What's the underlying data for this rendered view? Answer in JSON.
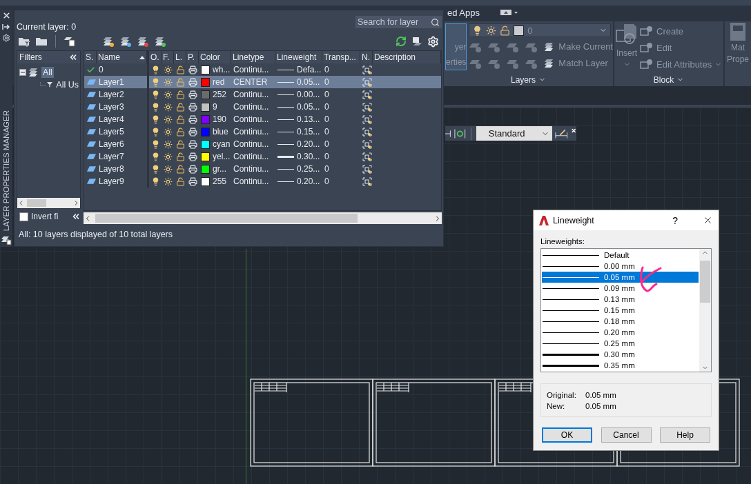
{
  "ribbon": {
    "tab_fragment": "ed Apps",
    "layers_panel": {
      "big_button": [
        "yer",
        "erties"
      ],
      "dropdown": {
        "value": "0",
        "color": "#c8ccd2"
      },
      "buttons": [
        "Make Current",
        "Match Layer"
      ],
      "title": "Layers"
    },
    "block_panel": {
      "insert": "Insert",
      "buttons": [
        "Create",
        "Edit",
        "Edit Attributes"
      ],
      "title": "Block"
    },
    "properties_panel": {
      "label": [
        "Mat",
        "Prope"
      ]
    }
  },
  "style_toolbar": {
    "value": "Standard"
  },
  "layer_manager": {
    "side_title": "LAYER PROPERTIES MANAGER",
    "current_layer": "Current layer: 0",
    "search": {
      "placeholder": "Search for layer"
    },
    "filters": {
      "title": "Filters",
      "tree": [
        {
          "label": "All",
          "selected": true,
          "expanded": true,
          "children": [
            {
              "label": "All Us",
              "selected": false
            }
          ]
        }
      ],
      "invert": {
        "label": "Invert fi",
        "checked": false
      }
    },
    "columns": [
      "S.",
      "Name",
      "O.",
      "F.",
      "L.",
      "P.",
      "Color",
      "Linetype",
      "Lineweight",
      "Transp...",
      "N.",
      "Description"
    ],
    "rows": [
      {
        "kind": "current",
        "name": "0",
        "color_name": "wh...",
        "color": "#ffffff",
        "linetype": "Continu...",
        "heavy": false,
        "lineweight": "Defa...",
        "transparency": "0",
        "selected": false
      },
      {
        "kind": "layer",
        "name": "Layer1",
        "color_name": "red",
        "color": "#ff0000",
        "linetype": "CENTER",
        "heavy": false,
        "lineweight": "0.05...",
        "transparency": "0",
        "selected": true
      },
      {
        "kind": "layer",
        "name": "Layer2",
        "color_name": "252",
        "color": "#6b6b6b",
        "linetype": "Continu...",
        "heavy": false,
        "lineweight": "0.00...",
        "transparency": "0",
        "selected": false
      },
      {
        "kind": "layer",
        "name": "Layer3",
        "color_name": "9",
        "color": "#c0c0c0",
        "linetype": "Continu...",
        "heavy": false,
        "lineweight": "0.05...",
        "transparency": "0",
        "selected": false
      },
      {
        "kind": "layer",
        "name": "Layer4",
        "color_name": "190",
        "color": "#7f00ff",
        "linetype": "Continu...",
        "heavy": false,
        "lineweight": "0.13...",
        "transparency": "0",
        "selected": false
      },
      {
        "kind": "layer",
        "name": "Layer5",
        "color_name": "blue",
        "color": "#0000ff",
        "linetype": "Continu...",
        "heavy": false,
        "lineweight": "0.15...",
        "transparency": "0",
        "selected": false
      },
      {
        "kind": "layer",
        "name": "Layer6",
        "color_name": "cyan",
        "color": "#00ffff",
        "linetype": "Continu...",
        "heavy": false,
        "lineweight": "0.20...",
        "transparency": "0",
        "selected": false
      },
      {
        "kind": "layer",
        "name": "Layer7",
        "color_name": "yel...",
        "color": "#ffff00",
        "linetype": "Continu...",
        "heavy": true,
        "lineweight": "0.30...",
        "transparency": "0",
        "selected": false
      },
      {
        "kind": "layer",
        "name": "Layer8",
        "color_name": "gr...",
        "color": "#00ff00",
        "linetype": "Continu...",
        "heavy": false,
        "lineweight": "0.25...",
        "transparency": "0",
        "selected": false
      },
      {
        "kind": "layer",
        "name": "Layer9",
        "color_name": "255",
        "color": "#ffffff",
        "linetype": "Continu...",
        "heavy": false,
        "lineweight": "0.20...",
        "transparency": "0",
        "selected": false
      }
    ],
    "status": "All: 10 layers displayed of 10 total layers"
  },
  "dialog": {
    "title": "Lineweight",
    "help": "?",
    "list_label": "Lineweights:",
    "items": [
      {
        "label": "Default",
        "heavy": false,
        "selected": false
      },
      {
        "label": "0.00 mm",
        "heavy": false,
        "selected": false
      },
      {
        "label": "0.05 mm",
        "heavy": false,
        "selected": true
      },
      {
        "label": "0.09 mm",
        "heavy": false,
        "selected": false
      },
      {
        "label": "0.13 mm",
        "heavy": false,
        "selected": false
      },
      {
        "label": "0.15 mm",
        "heavy": false,
        "selected": false
      },
      {
        "label": "0.18 mm",
        "heavy": false,
        "selected": false
      },
      {
        "label": "0.20 mm",
        "heavy": false,
        "selected": false
      },
      {
        "label": "0.25 mm",
        "heavy": false,
        "selected": false
      },
      {
        "label": "0.30 mm",
        "heavy": true,
        "selected": false
      },
      {
        "label": "0.35 mm",
        "heavy": true,
        "selected": false
      }
    ],
    "original_label": "Original:",
    "original": "0.05 mm",
    "new_label": "New:",
    "new": "0.05 mm",
    "buttons": [
      {
        "label": "OK",
        "default": true
      },
      {
        "label": "Cancel",
        "default": false
      },
      {
        "label": "Help",
        "default": false
      }
    ]
  }
}
